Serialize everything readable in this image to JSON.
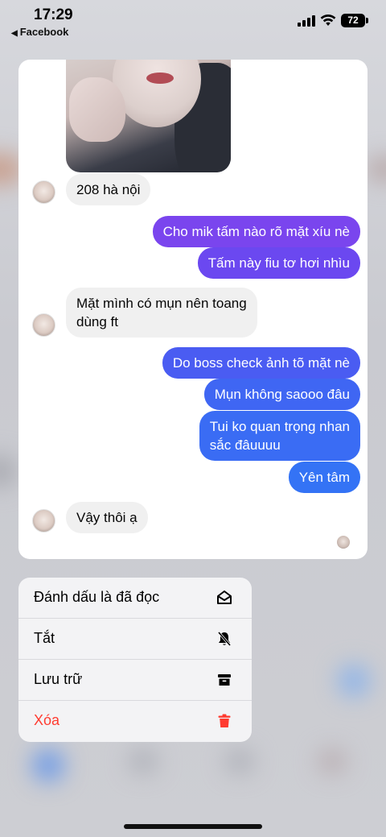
{
  "status_bar": {
    "time": "17:29",
    "back_app": "Facebook",
    "battery": "72"
  },
  "conversation": {
    "messages": [
      {
        "direction": "incoming",
        "text": "208 hà nội"
      },
      {
        "direction": "outgoing",
        "text": "Cho mik tấm nào rõ mặt xíu nè",
        "color": "#7a45ee"
      },
      {
        "direction": "outgoing",
        "text": "Tấm này fiu tơ hơi nhìu",
        "color": "#6b48f0"
      },
      {
        "direction": "incoming",
        "text_line1": "Mặt mình có mụn nên toang",
        "text_line2": "dùng ft"
      },
      {
        "direction": "outgoing",
        "text": "Do boss check ảnh tõ mặt nè",
        "color": "#4a5cf2"
      },
      {
        "direction": "outgoing",
        "text": "Mụn không saooo đâu",
        "color": "#3f66f3"
      },
      {
        "direction": "outgoing",
        "text_line1": "Tui ko quan trọng nhan",
        "text_line2": "sắc đâuuuu",
        "color": "#3a6cf4"
      },
      {
        "direction": "outgoing",
        "text": "Yên tâm",
        "color": "#3473f5"
      },
      {
        "direction": "incoming",
        "text": "Vậy thôi ạ"
      }
    ]
  },
  "context_menu": {
    "items": [
      {
        "label": "Đánh dấu là đã đọc",
        "icon": "envelope-open-icon"
      },
      {
        "label": "Tắt",
        "icon": "bell-slash-icon"
      },
      {
        "label": "Lưu trữ",
        "icon": "archive-box-icon"
      },
      {
        "label": "Xóa",
        "icon": "trash-icon",
        "destructive": true,
        "color": "#ff3b30"
      }
    ]
  }
}
